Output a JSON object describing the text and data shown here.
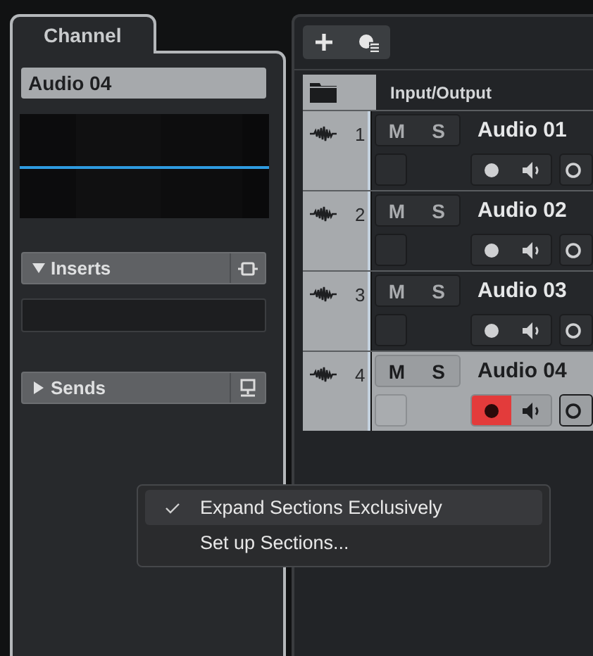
{
  "inspector": {
    "tab": "Channel",
    "channel_name": "Audio 04",
    "sections": [
      {
        "kind": "inserts",
        "title": "Inserts",
        "expanded": true
      },
      {
        "kind": "sends",
        "title": "Sends",
        "expanded": false
      }
    ]
  },
  "track_list": {
    "header": "Input/Output",
    "tracks": [
      {
        "number": "1",
        "name": "Audio 01",
        "mute": "M",
        "solo": "S",
        "selected": false,
        "record_armed": false
      },
      {
        "number": "2",
        "name": "Audio 02",
        "mute": "M",
        "solo": "S",
        "selected": false,
        "record_armed": false
      },
      {
        "number": "3",
        "name": "Audio 03",
        "mute": "M",
        "solo": "S",
        "selected": false,
        "record_armed": false
      },
      {
        "number": "4",
        "name": "Audio 04",
        "mute": "M",
        "solo": "S",
        "selected": true,
        "record_armed": true
      }
    ]
  },
  "context_menu": {
    "items": [
      {
        "label": "Expand Sections Exclusively",
        "checked": true,
        "highlighted": true
      },
      {
        "label": "Set up Sections...",
        "checked": false,
        "highlighted": false
      }
    ]
  }
}
